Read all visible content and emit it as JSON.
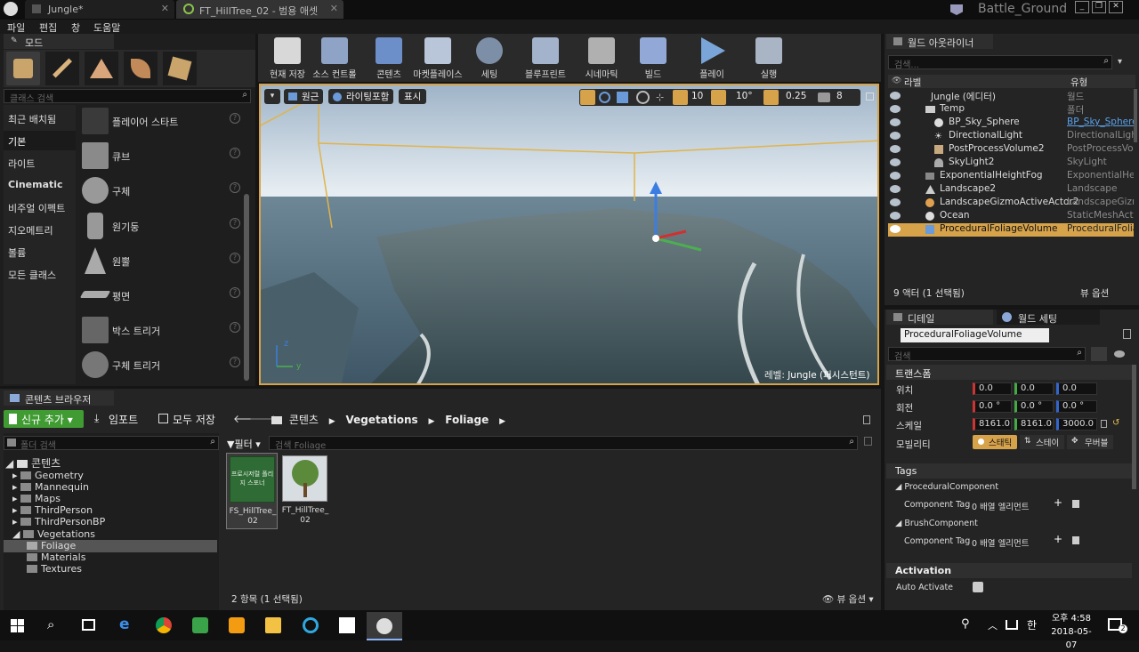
{
  "window": {
    "tabs": [
      {
        "label": "Jungle*"
      },
      {
        "label": "FT_HillTree_02 - 범용 애셋"
      }
    ],
    "project": "Battle_Ground"
  },
  "menu": [
    "파일",
    "편집",
    "창",
    "도움말"
  ],
  "modes": {
    "header": "모드",
    "search_placeholder": "클래스 검색",
    "categories": [
      "최근 배치됨",
      "기본",
      "라이트",
      "Cinematic",
      "비주얼 이펙트",
      "지오메트리",
      "볼륨",
      "모든 클래스"
    ],
    "selected_category": "기본",
    "items": [
      "플레이어 스타트",
      "큐브",
      "구체",
      "원기둥",
      "원뿔",
      "평면",
      "박스 트리거",
      "구체 트리거"
    ]
  },
  "toolbar": [
    "현재 저장",
    "소스 컨트롤",
    "콘텐츠",
    "마켓플레이스",
    "세팅",
    "블루프린트",
    "시네마틱",
    "빌드",
    "플레이",
    "실행"
  ],
  "viewport": {
    "btn_perspective": "원근",
    "btn_lighting": "라이팅포함",
    "btn_show": "표시",
    "grid_snap": "10",
    "rot_snap": "10°",
    "scale_snap": "0.25",
    "cam_speed": "8",
    "level_label": "레벨:",
    "level_name": "Jungle (퍼시스턴트)"
  },
  "outliner": {
    "header": "월드 아웃라이너",
    "search_placeholder": "검색...",
    "col_label": "라벨",
    "col_type": "유형",
    "rows": [
      {
        "name": "Jungle (에디터)",
        "type": "월드"
      },
      {
        "name": "Temp",
        "type": "폴더"
      },
      {
        "name": "BP_Sky_Sphere",
        "type": "BP_Sky_Sphere"
      },
      {
        "name": "DirectionalLight",
        "type": "DirectionalLight"
      },
      {
        "name": "PostProcessVolume2",
        "type": "PostProcessVol"
      },
      {
        "name": "SkyLight2",
        "type": "SkyLight"
      },
      {
        "name": "ExponentialHeightFog",
        "type": "ExponentialHeig"
      },
      {
        "name": "Landscape2",
        "type": "Landscape"
      },
      {
        "name": "LandscapeGizmoActiveActor2",
        "type": "LandscapeGizm"
      },
      {
        "name": "Ocean",
        "type": "StaticMeshActor"
      },
      {
        "name": "ProceduralFoliageVolume",
        "type": "ProceduralFolia"
      }
    ],
    "status": "9 액터 (1 선택됨)",
    "view_options": "뷰 옵션"
  },
  "details": {
    "tab_details": "디테일",
    "tab_world": "월드 세팅",
    "object_name": "ProceduralFoliageVolume",
    "search_placeholder": "검색",
    "transform_title": "트랜스폼",
    "location_label": "위치",
    "rotation_label": "회전",
    "scale_label": "스케일",
    "mobility_label": "모빌리티",
    "location": [
      "0.0",
      "0.0",
      "0.0"
    ],
    "rotation": [
      "0.0 °",
      "0.0 °",
      "0.0 °"
    ],
    "scale": [
      "8161.0",
      "8161.0",
      "3000.0"
    ],
    "mobility": [
      "스태틱",
      "스테이",
      "무버블"
    ],
    "tags_title": "Tags",
    "procedural_component": "ProceduralComponent",
    "brush_component": "BrushComponent",
    "component_tags_label": "Component Tags",
    "array_elements": "0 배열 엘리먼트",
    "activation_title": "Activation",
    "auto_activate": "Auto Activate"
  },
  "content_browser": {
    "header": "콘텐츠 브라우저",
    "btn_add": "신규 추가",
    "btn_import": "임포트",
    "btn_save_all": "모두 저장",
    "path": [
      "콘텐츠",
      "Vegetations",
      "Foliage"
    ],
    "folder_search_placeholder": "폴더 검색",
    "filter_label": "필터",
    "search_placeholder": "검색 Foliage",
    "tree": {
      "root": "콘텐츠",
      "items": [
        "Geometry",
        "Mannequin",
        "Maps",
        "ThirdPerson",
        "ThirdPersonBP",
        "Vegetations"
      ],
      "sub_items": [
        "Foliage",
        "Materials",
        "Textures"
      ]
    },
    "assets": [
      {
        "thumb_text": "프로시저럴 폴리지 스포너",
        "name": "FS_HillTree_02"
      },
      {
        "thumb_text": "",
        "name": "FT_HillTree_02"
      }
    ],
    "status": "2 항목 (1 선택됨)",
    "view_options": "뷰 옵션"
  },
  "taskbar": {
    "time": "오후 4:58",
    "date": "2018-05-07",
    "ime": "한",
    "notification_count": "2"
  }
}
